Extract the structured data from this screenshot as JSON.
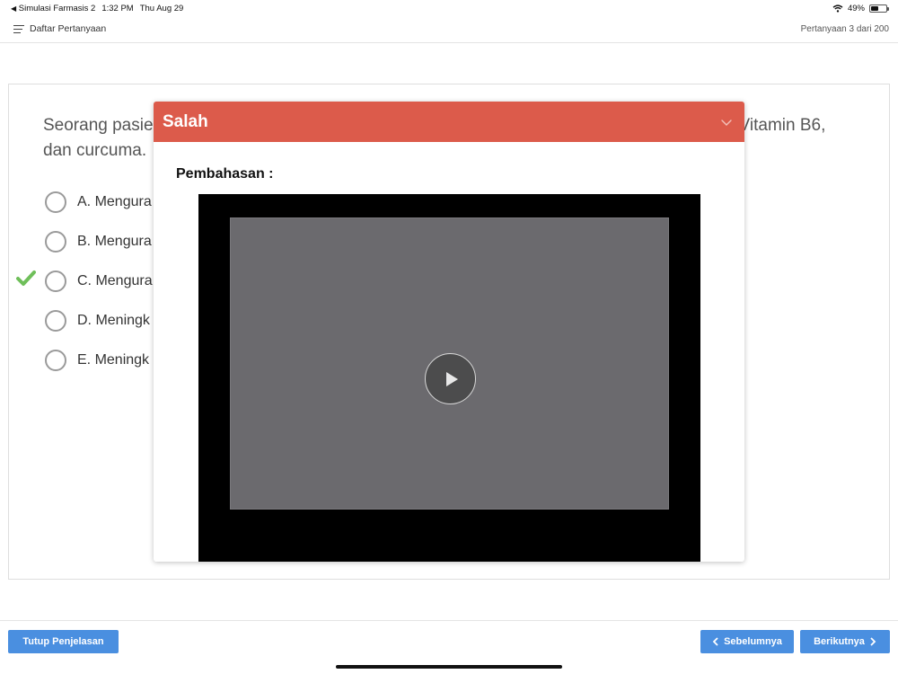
{
  "status_bar": {
    "back_app": "Simulasi Farmasis 2",
    "time": "1:32 PM",
    "date": "Thu Aug 29",
    "battery": "49%",
    "battery_level": 0.49
  },
  "header": {
    "menu_label": "Daftar Pertanyaan",
    "progress": "Pertanyaan 3 dari 200"
  },
  "question": {
    "text_start": "Seorang pasie",
    "text_end": "Vitamin B6,",
    "text_line2": "dan curcuma."
  },
  "options": [
    {
      "label": "A. Mengura"
    },
    {
      "label": "B. Mengura"
    },
    {
      "label": "C. Mengura",
      "correct": true
    },
    {
      "label": "D. Meningk"
    },
    {
      "label": "E. Meningk"
    }
  ],
  "modal": {
    "title": "Salah",
    "subtitle": "Pembahasan :",
    "header_color": "#dc5b4b"
  },
  "footer": {
    "close_label": "Tutup Penjelasan",
    "prev_label": "Sebelumnya",
    "next_label": "Berikutnya",
    "button_color": "#4a8fe0"
  }
}
